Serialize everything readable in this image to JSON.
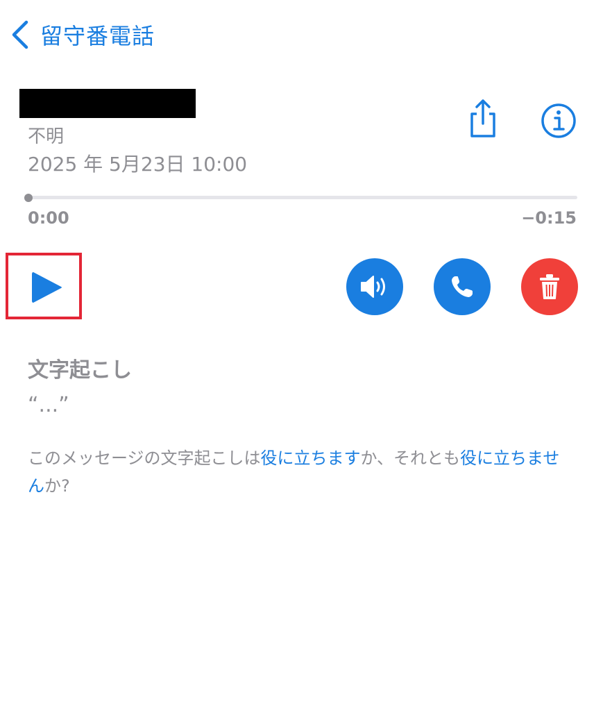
{
  "colors": {
    "accent": "#1a7ee0",
    "destructive": "#f0403a",
    "secondary_text": "#8e8e93",
    "highlight_box": "#e32636"
  },
  "nav": {
    "back_label": "留守番電話",
    "back_icon": "chevron-left-icon"
  },
  "voicemail": {
    "caller_label": "不明",
    "datetime": "2025 年 5月23日 10:00"
  },
  "actions": {
    "share_icon": "share-icon",
    "info_icon": "info-icon",
    "play_icon": "play-icon",
    "speaker_icon": "speaker-icon",
    "call_icon": "phone-icon",
    "delete_icon": "trash-icon"
  },
  "playback": {
    "elapsed": "0:00",
    "remaining": "−0:15",
    "progress_fraction": 0
  },
  "transcript": {
    "title": "文字起こし",
    "text": "“...”",
    "feedback_prefix": "このメッセージの文字起こしは",
    "feedback_helpful": "役に立ちます",
    "feedback_middle": "か、それとも",
    "feedback_not_helpful": "役に立ちません",
    "feedback_suffix": "か?"
  }
}
